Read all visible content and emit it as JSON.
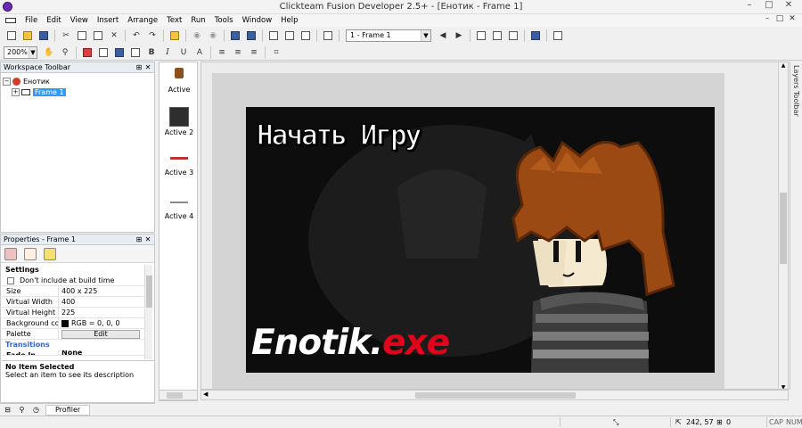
{
  "window": {
    "title": "Clickteam Fusion Developer 2.5+ - [Енотик - Frame 1]",
    "min": "–",
    "max": "□",
    "close": "✕"
  },
  "menu": [
    "File",
    "Edit",
    "View",
    "Insert",
    "Arrange",
    "Text",
    "Run",
    "Tools",
    "Window",
    "Help"
  ],
  "toolbar": {
    "frame_select": "1 - Frame 1",
    "zoom": "200%"
  },
  "workspace": {
    "title": "Workspace Toolbar",
    "app_name": "Енотик",
    "frame_name": "Frame 1"
  },
  "properties": {
    "title": "Properties - Frame 1",
    "section": "Settings",
    "dont_include": "Don't include at build time",
    "rows": [
      {
        "key": "Size",
        "value": "400 x 225"
      },
      {
        "key": "Virtual Width",
        "value": "400"
      },
      {
        "key": "Virtual Height",
        "value": "225"
      },
      {
        "key": "Background color",
        "value": "RGB = 0, 0, 0"
      },
      {
        "key": "Palette",
        "value": "Edit"
      }
    ],
    "subsection": "Transitions",
    "cutoff_key": "Fade In",
    "cutoff_value": "None",
    "desc_title": "No Item Selected",
    "desc_text": "Select an item to see its description"
  },
  "left_tabs": {
    "profiler": "Profiler"
  },
  "shelf": [
    {
      "label": "Active"
    },
    {
      "label": "Active 2"
    },
    {
      "label": "Active 3"
    },
    {
      "label": "Active 4"
    }
  ],
  "game": {
    "title": "Начать Игру",
    "logo_main": "Enotik.",
    "logo_exe": "exe",
    "bg_color": "#000000"
  },
  "layers": {
    "label": "Layers Toolbar"
  },
  "status": {
    "coords": "242, 57",
    "count": "0",
    "caps": "CAP",
    "num": "NUM"
  }
}
